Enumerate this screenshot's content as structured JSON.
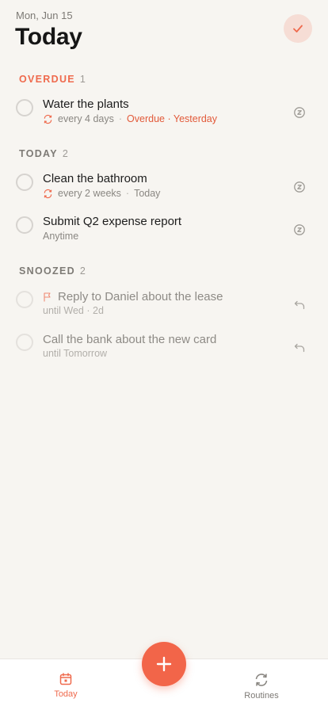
{
  "header": {
    "date": "Mon, Jun 15",
    "title": "Today",
    "complete_icon": "check-icon"
  },
  "sections": {
    "overdue": {
      "label": "OVERDUE",
      "count": "1"
    },
    "today": {
      "label": "TODAY",
      "count": "2"
    },
    "snoozed": {
      "label": "SNOOZED",
      "count": "2"
    }
  },
  "tasks": {
    "water_plants": {
      "title": "Water the plants",
      "repeat": "every 4 days",
      "overdue_text": "Overdue · Yesterday",
      "action_icon": "snooze-icon"
    },
    "clean_bathroom": {
      "title": "Clean the bathroom",
      "repeat": "every 2 weeks",
      "when": "Today",
      "action_icon": "snooze-icon"
    },
    "expense_report": {
      "title": "Submit Q2 expense report",
      "when": "Anytime",
      "action_icon": "snooze-icon"
    },
    "reply_daniel": {
      "title": "Reply to Daniel about the lease",
      "until": "until Wed · 2d",
      "action_icon": "unsnooze-icon"
    },
    "call_bank": {
      "title": "Call the bank about the new card",
      "until": "until Tomorrow",
      "action_icon": "unsnooze-icon"
    }
  },
  "tabbar": {
    "today_label": "Today",
    "routines_label": "Routines",
    "add_icon": "plus-icon"
  },
  "colors": {
    "accent": "#f26549",
    "overdue": "#e25a3a",
    "background": "#f7f5f1"
  }
}
